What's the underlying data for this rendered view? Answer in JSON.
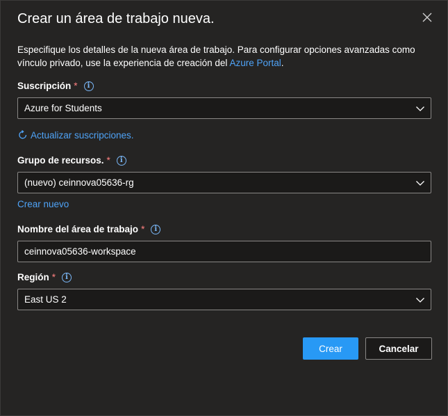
{
  "dialog": {
    "title": "Crear un área de trabajo nueva.",
    "description_prefix": "Especifique los detalles de la nueva área de trabajo. Para configurar opciones avanzadas como vínculo privado, use la experiencia de creación del ",
    "description_link": "Azure Portal",
    "description_suffix": "."
  },
  "subscription": {
    "label": "Suscripción",
    "required": "*",
    "value": "Azure for Students",
    "refresh_label": "Actualizar suscripciones."
  },
  "resource_group": {
    "label": "Grupo de recursos.",
    "required": "*",
    "value": "(nuevo) ceinnova05636-rg",
    "create_new_label": "Crear nuevo"
  },
  "workspace_name": {
    "label": "Nombre del área de trabajo",
    "required": "*",
    "value": "ceinnova05636-workspace"
  },
  "region": {
    "label": "Región",
    "required": "*",
    "value": "East US 2"
  },
  "buttons": {
    "create_label": "Crear",
    "cancel_label": "Cancelar"
  },
  "colors": {
    "accent": "#2899f5",
    "link": "#4fa3f7",
    "background": "#252423",
    "required": "#ff8080"
  }
}
